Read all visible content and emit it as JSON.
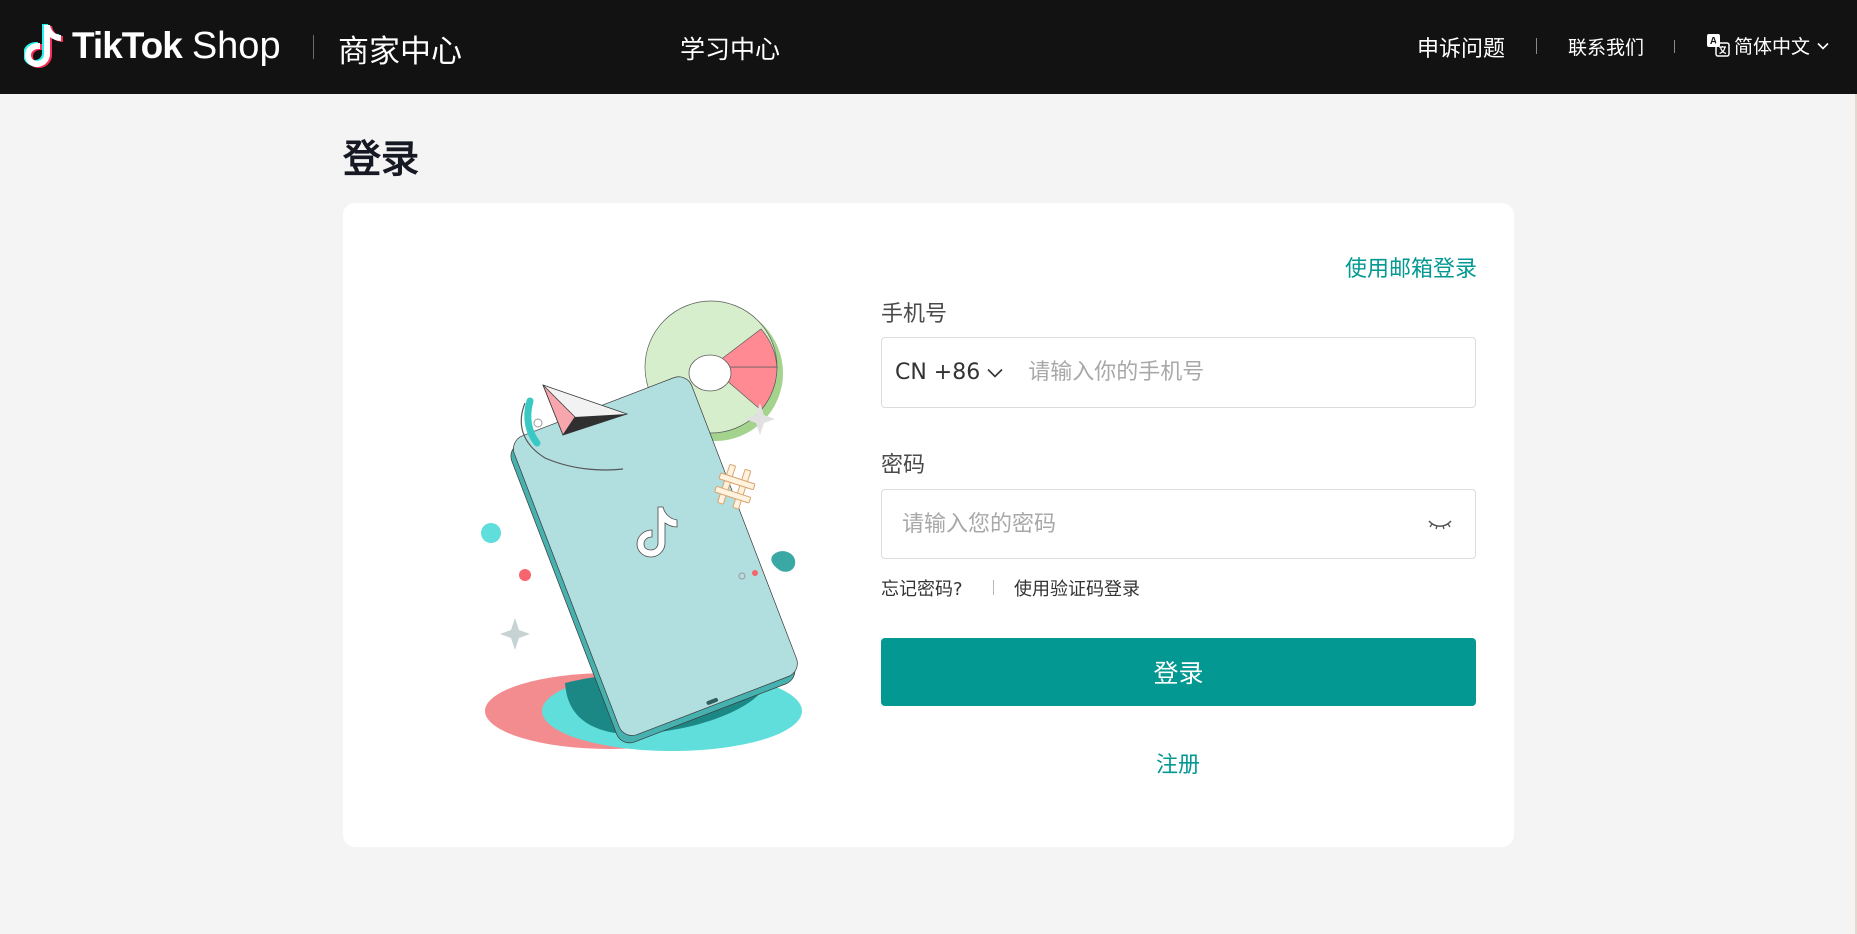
{
  "header": {
    "brand_name": "TikTok",
    "brand_suffix": "Shop",
    "merchant_center": "商家中心",
    "learning_center": "学习中心",
    "appeal": "申诉问题",
    "contact": "联系我们",
    "language": "简体中文"
  },
  "page": {
    "title": "登录"
  },
  "form": {
    "email_login_link": "使用邮箱登录",
    "phone_label": "手机号",
    "country_code": "CN +86",
    "phone_placeholder": "请输入你的手机号",
    "password_label": "密码",
    "password_placeholder": "请输入您的密码",
    "forgot_password": "忘记密码?",
    "code_login": "使用验证码登录",
    "login_button": "登录",
    "register": "注册"
  },
  "colors": {
    "accent": "#039892",
    "header_bg": "#121212",
    "page_bg": "#f4f4f4"
  }
}
